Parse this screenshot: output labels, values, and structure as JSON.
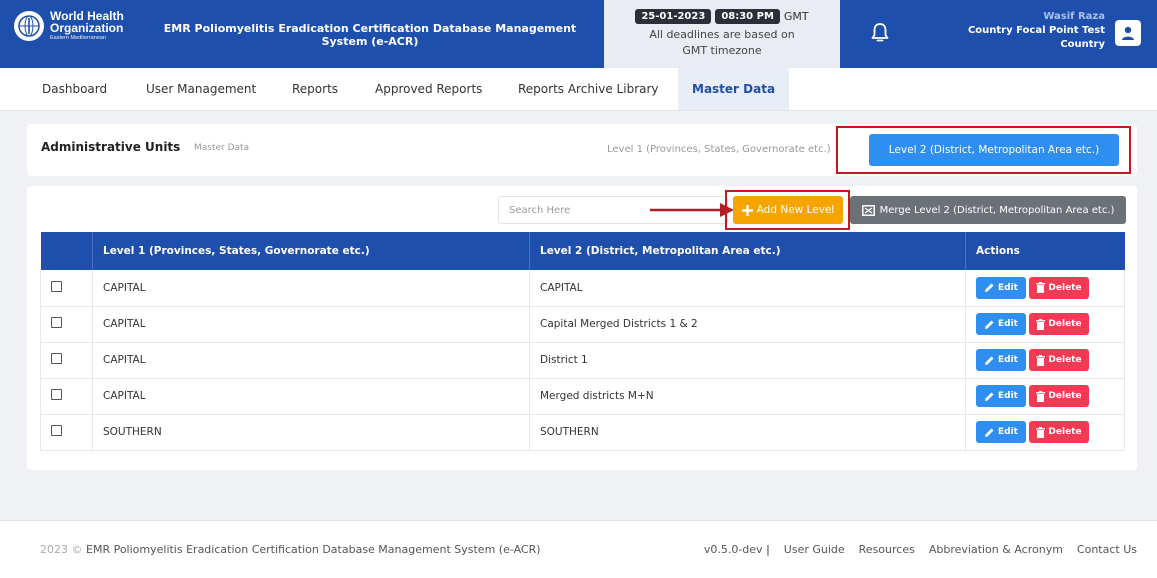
{
  "header": {
    "logo": {
      "line1": "World Health",
      "line2": "Organization",
      "line3": "Eastern Mediterranean"
    },
    "app_title": "EMR Poliomyelitis Eradication Certification Database Management System (e-ACR)",
    "date": "25-01-2023",
    "time": "08:30 PM",
    "tz": "GMT",
    "deadline_note": "All deadlines are based on GMT timezone",
    "user_name": "Wasif Raza",
    "user_role": "Country Focal Point Test",
    "user_scope": "Country"
  },
  "nav": {
    "items": [
      {
        "label": "Dashboard"
      },
      {
        "label": "User Management"
      },
      {
        "label": "Reports"
      },
      {
        "label": "Approved Reports"
      },
      {
        "label": "Reports Archive Library"
      },
      {
        "label": "Master Data"
      }
    ],
    "active": "Master Data"
  },
  "admin": {
    "title": "Administrative Units",
    "subtitle": "Master Data",
    "level1_tab": "Level 1 (Provinces, States, Governorate etc.)",
    "level2_tab": "Level 2 (District, Metropolitan Area etc.)"
  },
  "toolbar": {
    "search_placeholder": "Search Here",
    "add_label": "Add New Level",
    "merge_label": "Merge Level 2 (District, Metropolitan Area etc.)"
  },
  "table": {
    "headers": {
      "col1": "Level 1 (Provinces, States, Governorate etc.)",
      "col2": "Level 2 (District, Metropolitan Area etc.)",
      "col3": "Actions"
    },
    "edit_label": "Edit",
    "delete_label": "Delete",
    "rows": [
      {
        "level1": "CAPITAL",
        "level2": "CAPITAL"
      },
      {
        "level1": "CAPITAL",
        "level2": "Capital Merged Districts 1 & 2"
      },
      {
        "level1": "CAPITAL",
        "level2": "District 1"
      },
      {
        "level1": "CAPITAL",
        "level2": "Merged districts M+N"
      },
      {
        "level1": "SOUTHERN",
        "level2": "SOUTHERN"
      }
    ]
  },
  "footer": {
    "year": "2023 ©",
    "system": "EMR Poliomyelitis Eradication Certification Database Management System (e-ACR)",
    "version": "v0.5.0-dev",
    "separator": "|",
    "links": [
      "User Guide",
      "Resources",
      "Abbreviation & Acronym",
      "Contact Us"
    ]
  },
  "colors": {
    "primary": "#1f4fad",
    "accent_blue": "#2f8ff0",
    "add_orange": "#f6a400",
    "delete_red": "#f23a55",
    "highlight_red": "#c8181f"
  }
}
